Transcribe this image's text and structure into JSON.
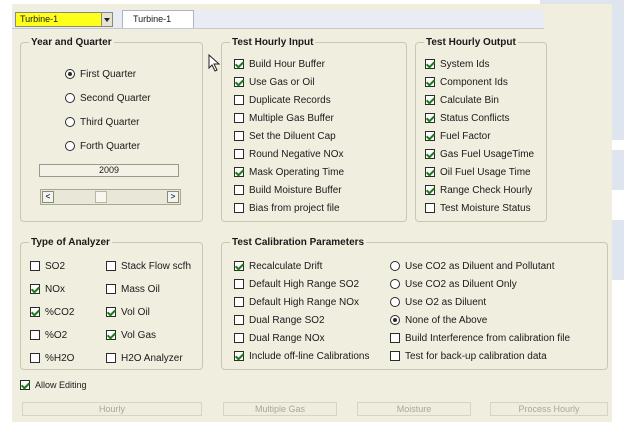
{
  "toolbar": {
    "selected_item": "Turbine-1",
    "tab_label": "Turbine-1"
  },
  "year_quarter": {
    "title": "Year and Quarter",
    "quarters": [
      {
        "label": "First Quarter",
        "selected": true
      },
      {
        "label": "Second Quarter",
        "selected": false
      },
      {
        "label": "Third Quarter",
        "selected": false
      },
      {
        "label": "Forth Quarter",
        "selected": false
      }
    ],
    "year": "2009",
    "left_arrow": "<",
    "right_arrow": ">"
  },
  "hourly_input": {
    "title": "Test Hourly Input",
    "items": [
      {
        "label": "Build Hour Buffer",
        "checked": true
      },
      {
        "label": "Use Gas or Oil",
        "checked": true
      },
      {
        "label": "Duplicate Records",
        "checked": false
      },
      {
        "label": "Multiple Gas Buffer",
        "checked": false
      },
      {
        "label": "Set the Diluent Cap",
        "checked": false
      },
      {
        "label": "Round Negative NOx",
        "checked": false
      },
      {
        "label": "Mask Operating Time",
        "checked": true
      },
      {
        "label": "Build Moisture Buffer",
        "checked": false
      },
      {
        "label": "Bias from project file",
        "checked": false
      }
    ]
  },
  "hourly_output": {
    "title": "Test Hourly Output",
    "items": [
      {
        "label": "System Ids",
        "checked": true
      },
      {
        "label": "Component Ids",
        "checked": true
      },
      {
        "label": "Calculate Bin",
        "checked": true
      },
      {
        "label": "Status Conflicts",
        "checked": true
      },
      {
        "label": "Fuel Factor",
        "checked": true
      },
      {
        "label": "Gas Fuel UsageTime",
        "checked": true
      },
      {
        "label": "Oil Fuel Usage Time",
        "checked": true
      },
      {
        "label": "Range Check Hourly",
        "checked": true
      },
      {
        "label": "Test Moisture Status",
        "checked": false
      }
    ]
  },
  "analyzer": {
    "title": "Type of Analyzer",
    "col1": [
      {
        "label": "SO2",
        "checked": false
      },
      {
        "label": "NOx",
        "checked": true
      },
      {
        "label": "%CO2",
        "checked": true
      },
      {
        "label": "%O2",
        "checked": false
      },
      {
        "label": "%H2O",
        "checked": false
      }
    ],
    "col2": [
      {
        "label": "Stack Flow scfh",
        "checked": false
      },
      {
        "label": "Mass Oil",
        "checked": false
      },
      {
        "label": "Vol Oil",
        "checked": true
      },
      {
        "label": "Vol  Gas",
        "checked": true
      },
      {
        "label": "H2O Analyzer",
        "checked": false
      }
    ]
  },
  "calibration": {
    "title": "Test Calibration Parameters",
    "checks": [
      {
        "label": "Recalculate Drift",
        "checked": true
      },
      {
        "label": "Default High Range SO2",
        "checked": false
      },
      {
        "label": "Default High Range NOx",
        "checked": false
      },
      {
        "label": "Dual Range SO2",
        "checked": false
      },
      {
        "label": "Dual Range NOx",
        "checked": false
      },
      {
        "label": "Include off-line Calibrations",
        "checked": true
      }
    ],
    "radios": [
      {
        "label": "Use CO2 as Diluent and Pollutant",
        "selected": false
      },
      {
        "label": "Use CO2 as Diluent Only",
        "selected": false
      },
      {
        "label": "Use O2 as Diluent",
        "selected": false
      },
      {
        "label": "None of the Above",
        "selected": true
      }
    ],
    "extra_checks": [
      {
        "label": "Build Interference from calibration file",
        "checked": false
      },
      {
        "label": "Test for back-up calibration data",
        "checked": false
      }
    ]
  },
  "allow_editing": {
    "label": "Allow Editing",
    "checked": true
  },
  "buttons": {
    "hourly": "Hourly",
    "multiple_gas": "Multiple Gas",
    "moisture": "Moisture",
    "process_hourly": "Process Hourly"
  }
}
